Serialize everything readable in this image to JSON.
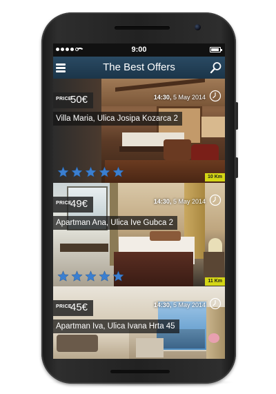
{
  "status_bar": {
    "time": "9:00"
  },
  "app_bar": {
    "title": "The Best Offers",
    "menu_icon": "menu-icon",
    "search_icon": "search-icon"
  },
  "offers": [
    {
      "price_label": "PRICE",
      "price": "50€",
      "time": "14:30,",
      "date": "5 May 2014",
      "name": "Villa Maria, Ulica Josipa Kozarca 2",
      "rating": 5,
      "distance": "10 Km"
    },
    {
      "price_label": "PRICE",
      "price": "49€",
      "time": "14:30,",
      "date": "5 May 2014",
      "name": "Apartman Ana, Ulica Ive Gubca 2",
      "rating": 5,
      "distance": "11 Km"
    },
    {
      "price_label": "PRICE",
      "price": "45€",
      "time": "14:30,",
      "date": "5 May 2014",
      "name": "Apartman Iva, Ulica Ivana Hrta 45"
    }
  ],
  "colors": {
    "app_bar": "#1f3b50",
    "star": "#3b7fd0",
    "distance_badge": "#d4d615"
  }
}
